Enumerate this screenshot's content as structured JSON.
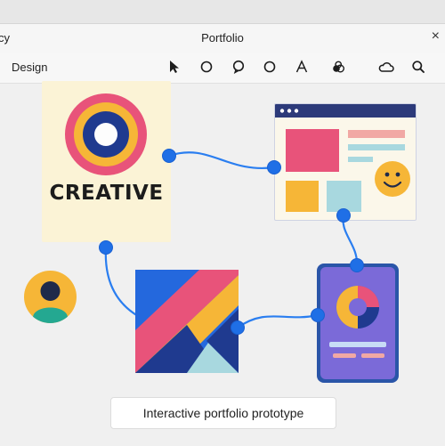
{
  "window": {
    "title": "Portfolio",
    "left_fragment": "cy",
    "close_glyph": "×"
  },
  "toolbar": {
    "tab_label": "Design",
    "tools": [
      {
        "name": "cursor-icon"
      },
      {
        "name": "circle-icon"
      },
      {
        "name": "speech-bubble-icon"
      },
      {
        "name": "circle-icon"
      },
      {
        "name": "text-icon"
      },
      {
        "name": "fill-icon"
      },
      {
        "name": "cloud-icon"
      },
      {
        "name": "search-icon"
      }
    ]
  },
  "canvas": {
    "creative_card": {
      "word": "CREATIVE"
    },
    "caption": "Interactive portfolio prototype"
  },
  "colors": {
    "accent": "#1f6fe6",
    "pink": "#e8537a",
    "yellow": "#f6b637",
    "navy": "#1f3a8f",
    "cream": "#fbf3d6",
    "phone_blue": "#2a55a8",
    "phone_purple": "#7b6ad8"
  }
}
